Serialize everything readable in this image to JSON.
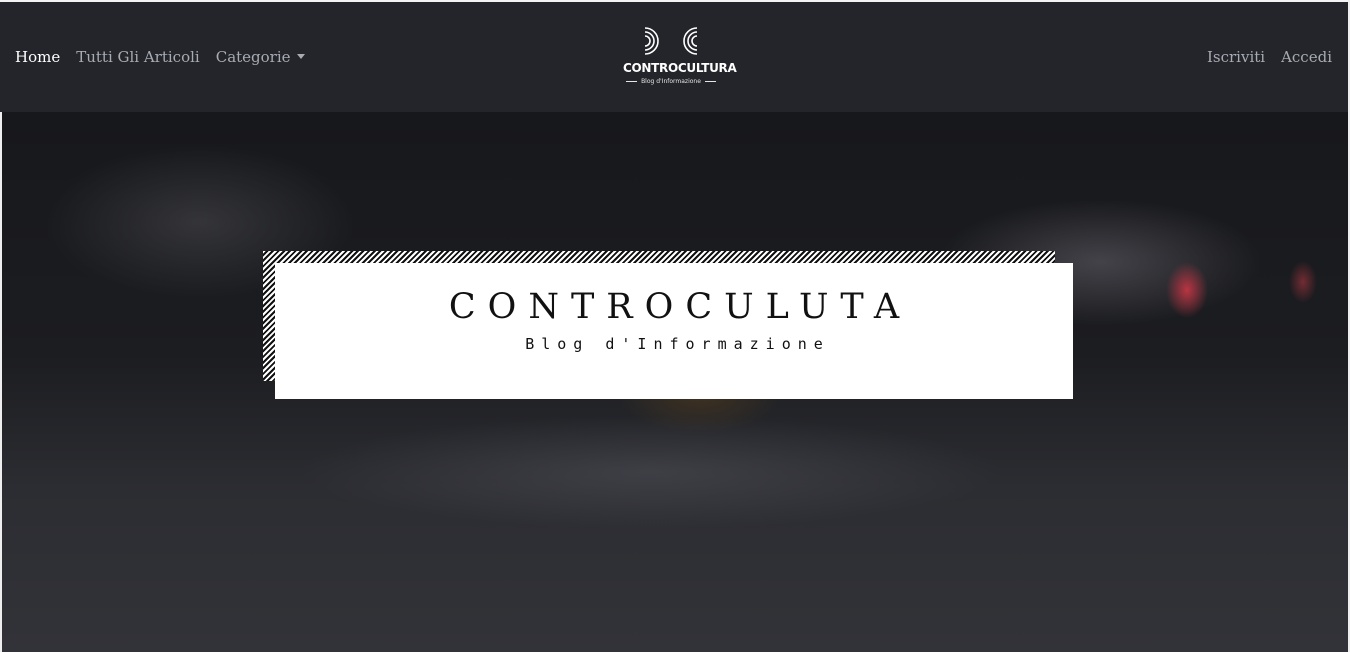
{
  "nav": {
    "left": [
      {
        "label": "Home",
        "active": true
      },
      {
        "label": "Tutti Gli Articoli",
        "active": false
      },
      {
        "label": "Categorie",
        "active": false
      }
    ],
    "right": [
      {
        "label": "Iscriviti"
      },
      {
        "label": "Accedi"
      }
    ]
  },
  "brand": {
    "name": "CONTROCULTURA",
    "tagline": "Blog d'Informazione"
  },
  "hero": {
    "title": "CONTROCULUTA",
    "subtitle": "Blog d'Informazione"
  },
  "colors": {
    "navbar": "#23252a",
    "nav_link": "#a8acb2",
    "nav_active": "#ffffff"
  }
}
